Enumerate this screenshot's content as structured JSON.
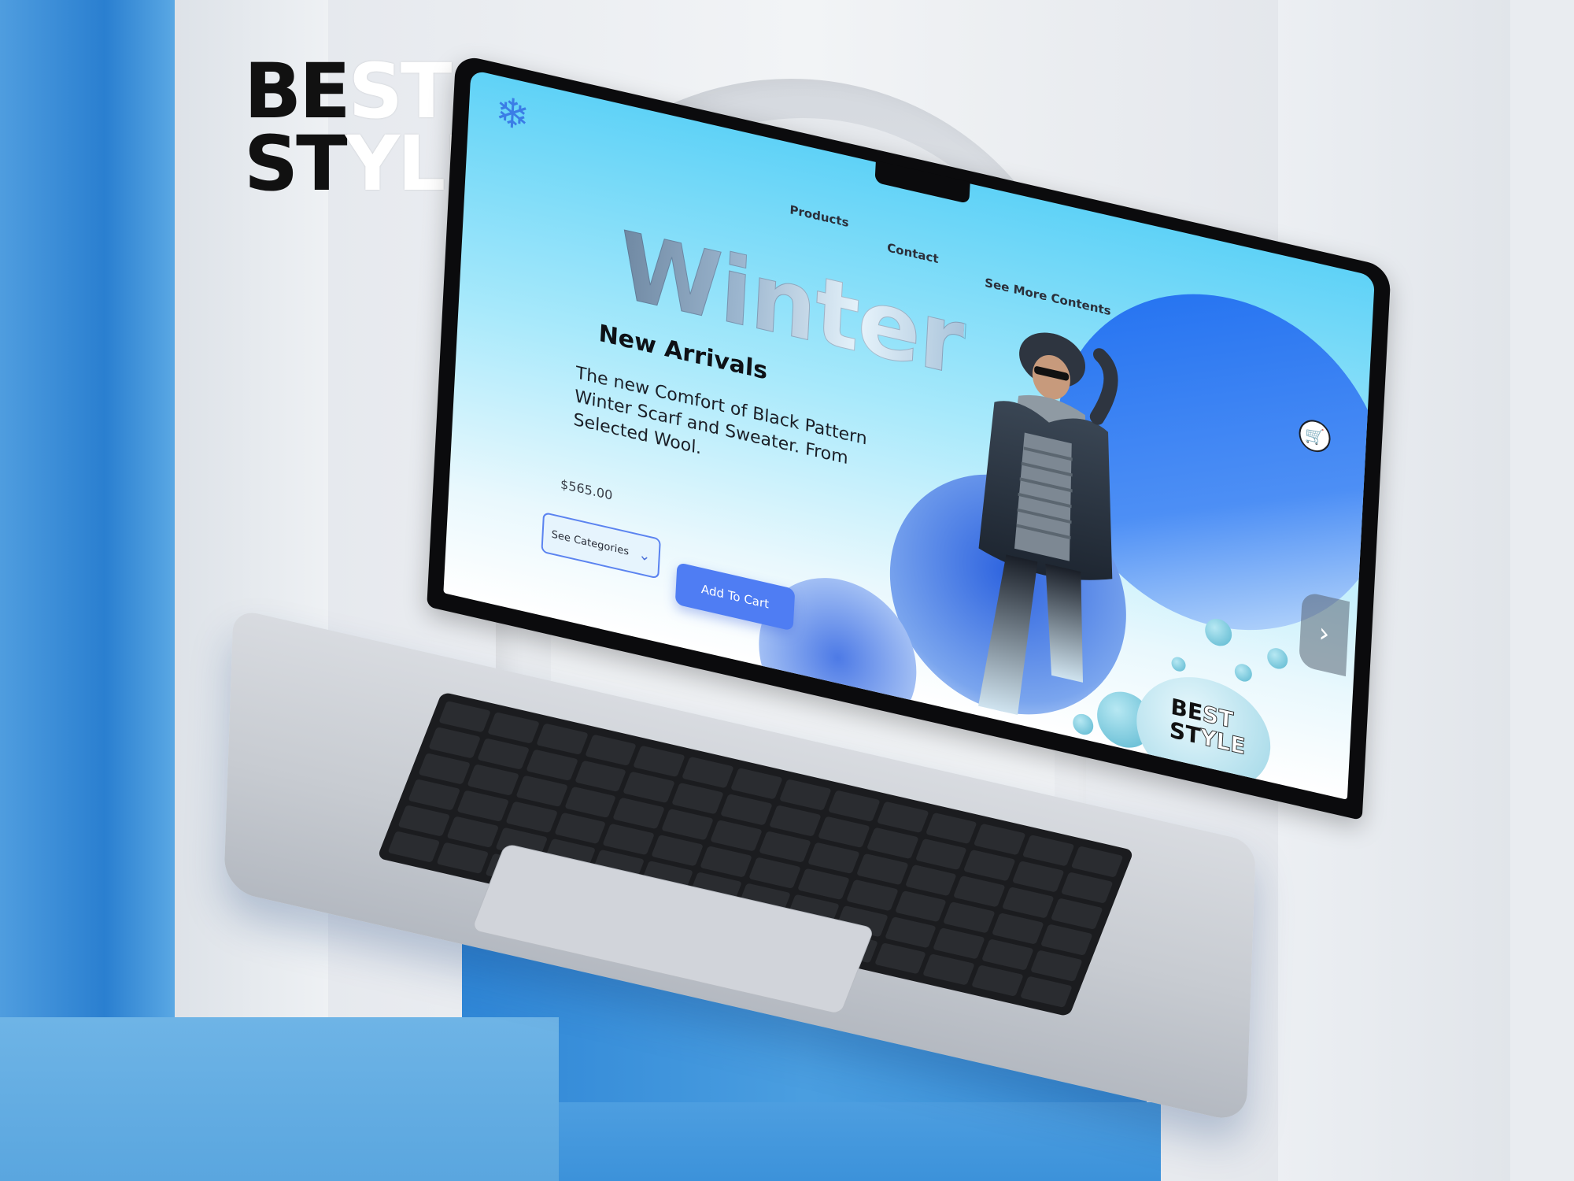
{
  "brand": {
    "line1_dark": "BE",
    "line1_light": "ST",
    "line2_dark": "ST",
    "line2_light": "YLE"
  },
  "site": {
    "nav": {
      "products": "Products",
      "contact": "Contact",
      "see_more": "See More Contents"
    },
    "hero_word": "Winter",
    "subhead": "New Arrivals",
    "description": "The new Comfort of Black Pattern Winter Scarf and Sweater. From Selected Wool.",
    "price": "$565.00",
    "category_select": "See Categories",
    "add_to_cart": "Add To Cart",
    "logo_icon": "snowflake-icon",
    "cart_icon": "shopping-cart-icon",
    "next_icon": "chevron-right-icon",
    "colors": {
      "accent": "#4f7df3",
      "hero_gradient_top": "#5fd2f7",
      "deep_blue": "#1f6ff0"
    }
  },
  "icons": {
    "snowflake": "❄",
    "chevron_down": "⌄",
    "cart": "🛒",
    "chevron_right": "›"
  }
}
